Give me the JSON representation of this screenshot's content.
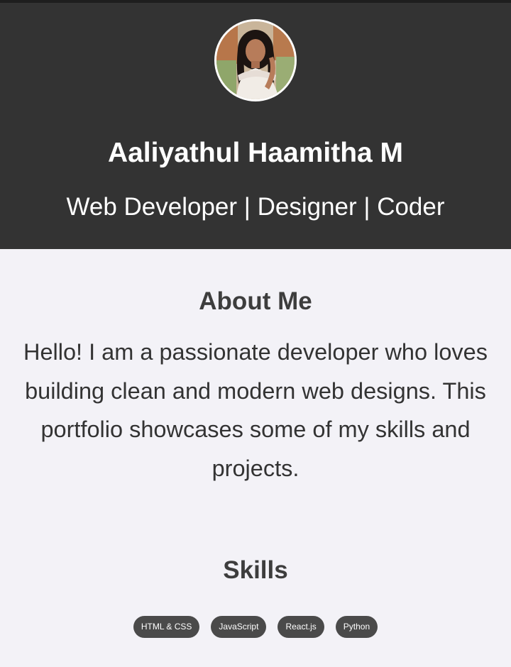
{
  "profile": {
    "name": "Aaliyathul Haamitha M",
    "tagline": "Web Developer | Designer | Coder",
    "avatar_icon": "profile-photo"
  },
  "about": {
    "heading": "About Me",
    "text": "Hello! I am a passionate developer who loves building clean and modern web designs. This portfolio showcases some of my skills and projects."
  },
  "skills": {
    "heading": "Skills",
    "items": [
      "HTML & CSS",
      "JavaScript",
      "React.js",
      "Python"
    ]
  },
  "colors": {
    "header_bg": "#333333",
    "page_bg": "#f3f2f7",
    "chip_bg": "#4a4a4a",
    "heading_text": "#3d3d3d"
  }
}
